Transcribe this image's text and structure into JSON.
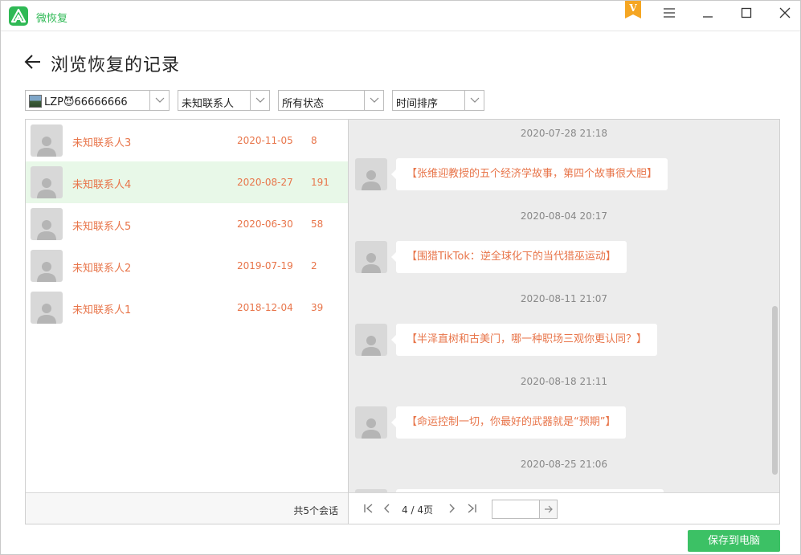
{
  "app": {
    "name": "微恢复",
    "vip_badge_letter": "V",
    "accent_color": "#2fb955",
    "badge_color": "#f5a623"
  },
  "window_controls": [
    "menu-icon",
    "minimize-icon",
    "maximize-icon",
    "close-icon"
  ],
  "page": {
    "title": "浏览恢复的记录",
    "back_icon": "arrow-left-icon"
  },
  "filters": {
    "account": "LZP😈66666666",
    "contact": "未知联系人",
    "status": "所有状态",
    "sort": "时间排序"
  },
  "conversations": [
    {
      "name": "未知联系人3",
      "date": "2020-11-05",
      "count": "8",
      "selected": false
    },
    {
      "name": "未知联系人4",
      "date": "2020-08-27",
      "count": "191",
      "selected": true
    },
    {
      "name": "未知联系人5",
      "date": "2020-06-30",
      "count": "58",
      "selected": false
    },
    {
      "name": "未知联系人2",
      "date": "2019-07-19",
      "count": "2",
      "selected": false
    },
    {
      "name": "未知联系人1",
      "date": "2018-12-04",
      "count": "39",
      "selected": false
    }
  ],
  "list_footer": {
    "total": "共5个会话"
  },
  "messages": [
    {
      "timestamp": "2020-07-28 21:18",
      "text": "【张维迎教授的五个经济学故事，第四个故事很大胆】"
    },
    {
      "timestamp": "2020-08-04 20:17",
      "text": "【围猎TikTok：逆全球化下的当代猎巫运动】"
    },
    {
      "timestamp": "2020-08-11 21:07",
      "text": "【半泽直树和古美门，哪一种职场三观你更认同？】"
    },
    {
      "timestamp": "2020-08-18 21:11",
      "text": "【命运控制一切，你最好的武器就是“预期”】"
    },
    {
      "timestamp": "2020-08-25 21:06",
      "text": ""
    }
  ],
  "pager": {
    "current": "4",
    "separator": "/",
    "total": "4页",
    "page_input": ""
  },
  "save_button": "保存到电脑"
}
